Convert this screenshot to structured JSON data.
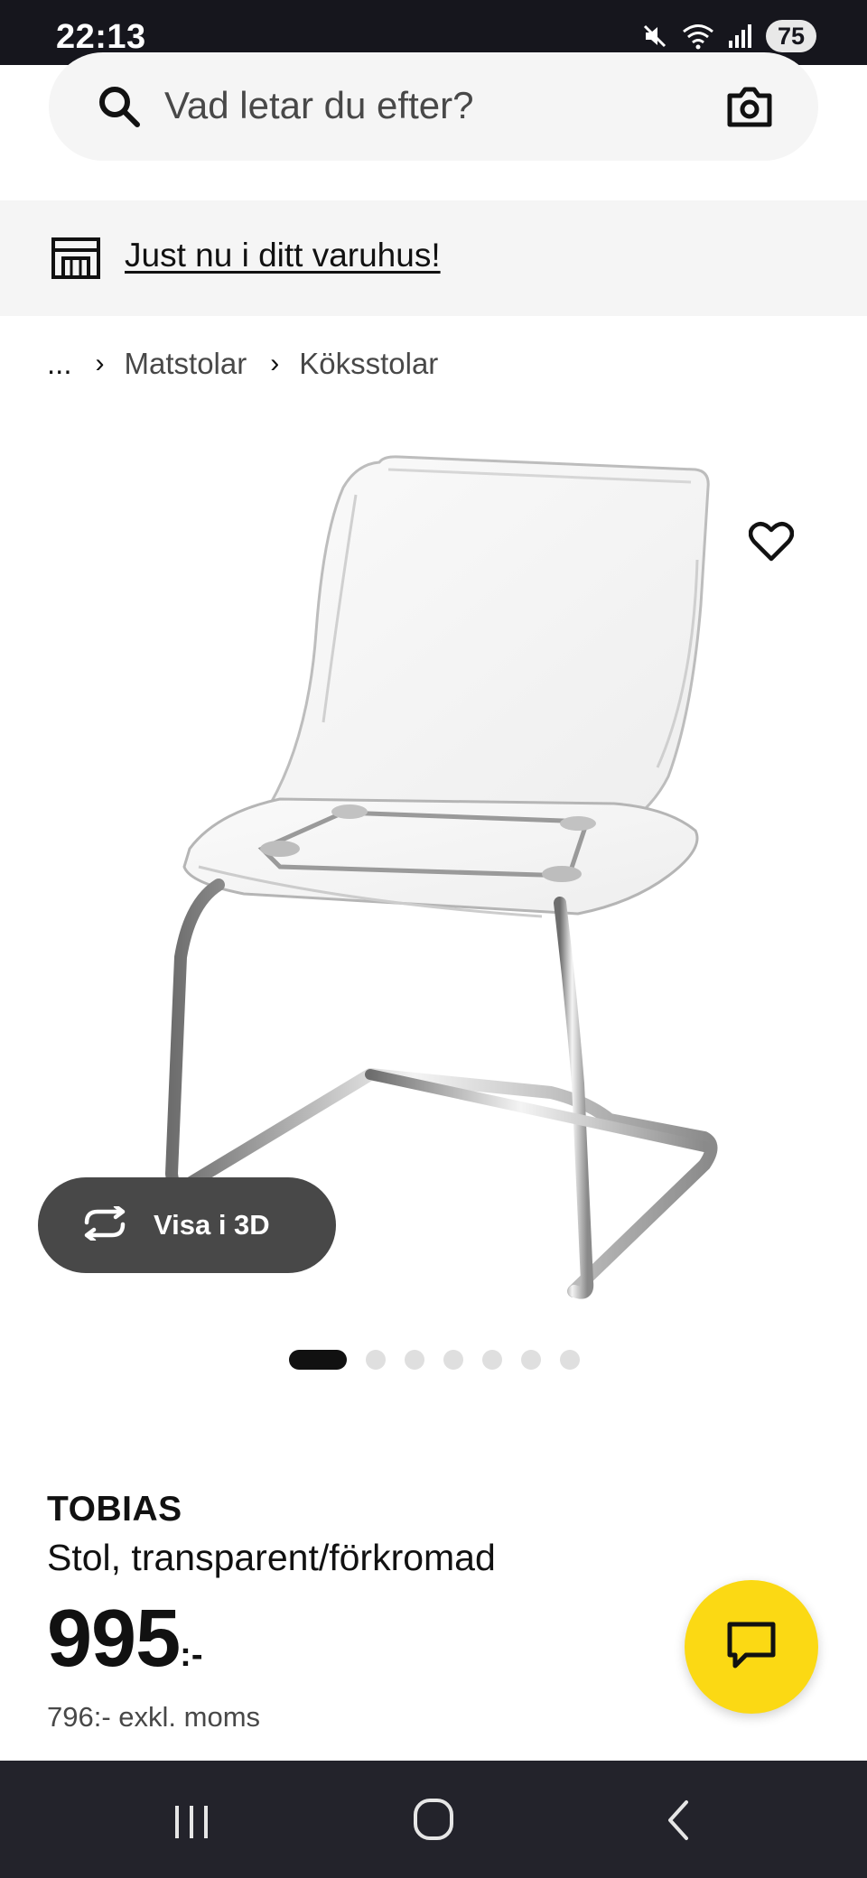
{
  "status_bar": {
    "time": "22:13",
    "battery": "75",
    "icons": [
      "mute-icon",
      "wifi-icon",
      "signal-icon",
      "battery-icon"
    ]
  },
  "search": {
    "placeholder": "Vad letar du efter?",
    "icons": [
      "search-icon",
      "camera-icon"
    ]
  },
  "store_banner": {
    "link_text": "Just nu i ditt varuhus!",
    "icon": "store-icon"
  },
  "breadcrumb": {
    "ellipsis": "...",
    "items": [
      "Matstolar",
      "Köksstolar"
    ]
  },
  "gallery": {
    "view_3d_label": "Visa i 3D",
    "image_count": 7,
    "active_index": 0,
    "icons": [
      "heart-icon",
      "rotate-3d-icon"
    ]
  },
  "product": {
    "name": "TOBIAS",
    "description": "Stol, transparent/förkromad",
    "price": "995",
    "price_suffix": ":-",
    "price_excl_vat": "796:- exkl. moms"
  },
  "colors": {
    "accent_yellow": "#fbd914",
    "text_dark": "#111111",
    "text_secondary": "#484848",
    "background_gray": "#f5f5f5"
  },
  "nav_bar": {
    "buttons": [
      "recents-icon",
      "home-icon",
      "back-icon"
    ]
  }
}
